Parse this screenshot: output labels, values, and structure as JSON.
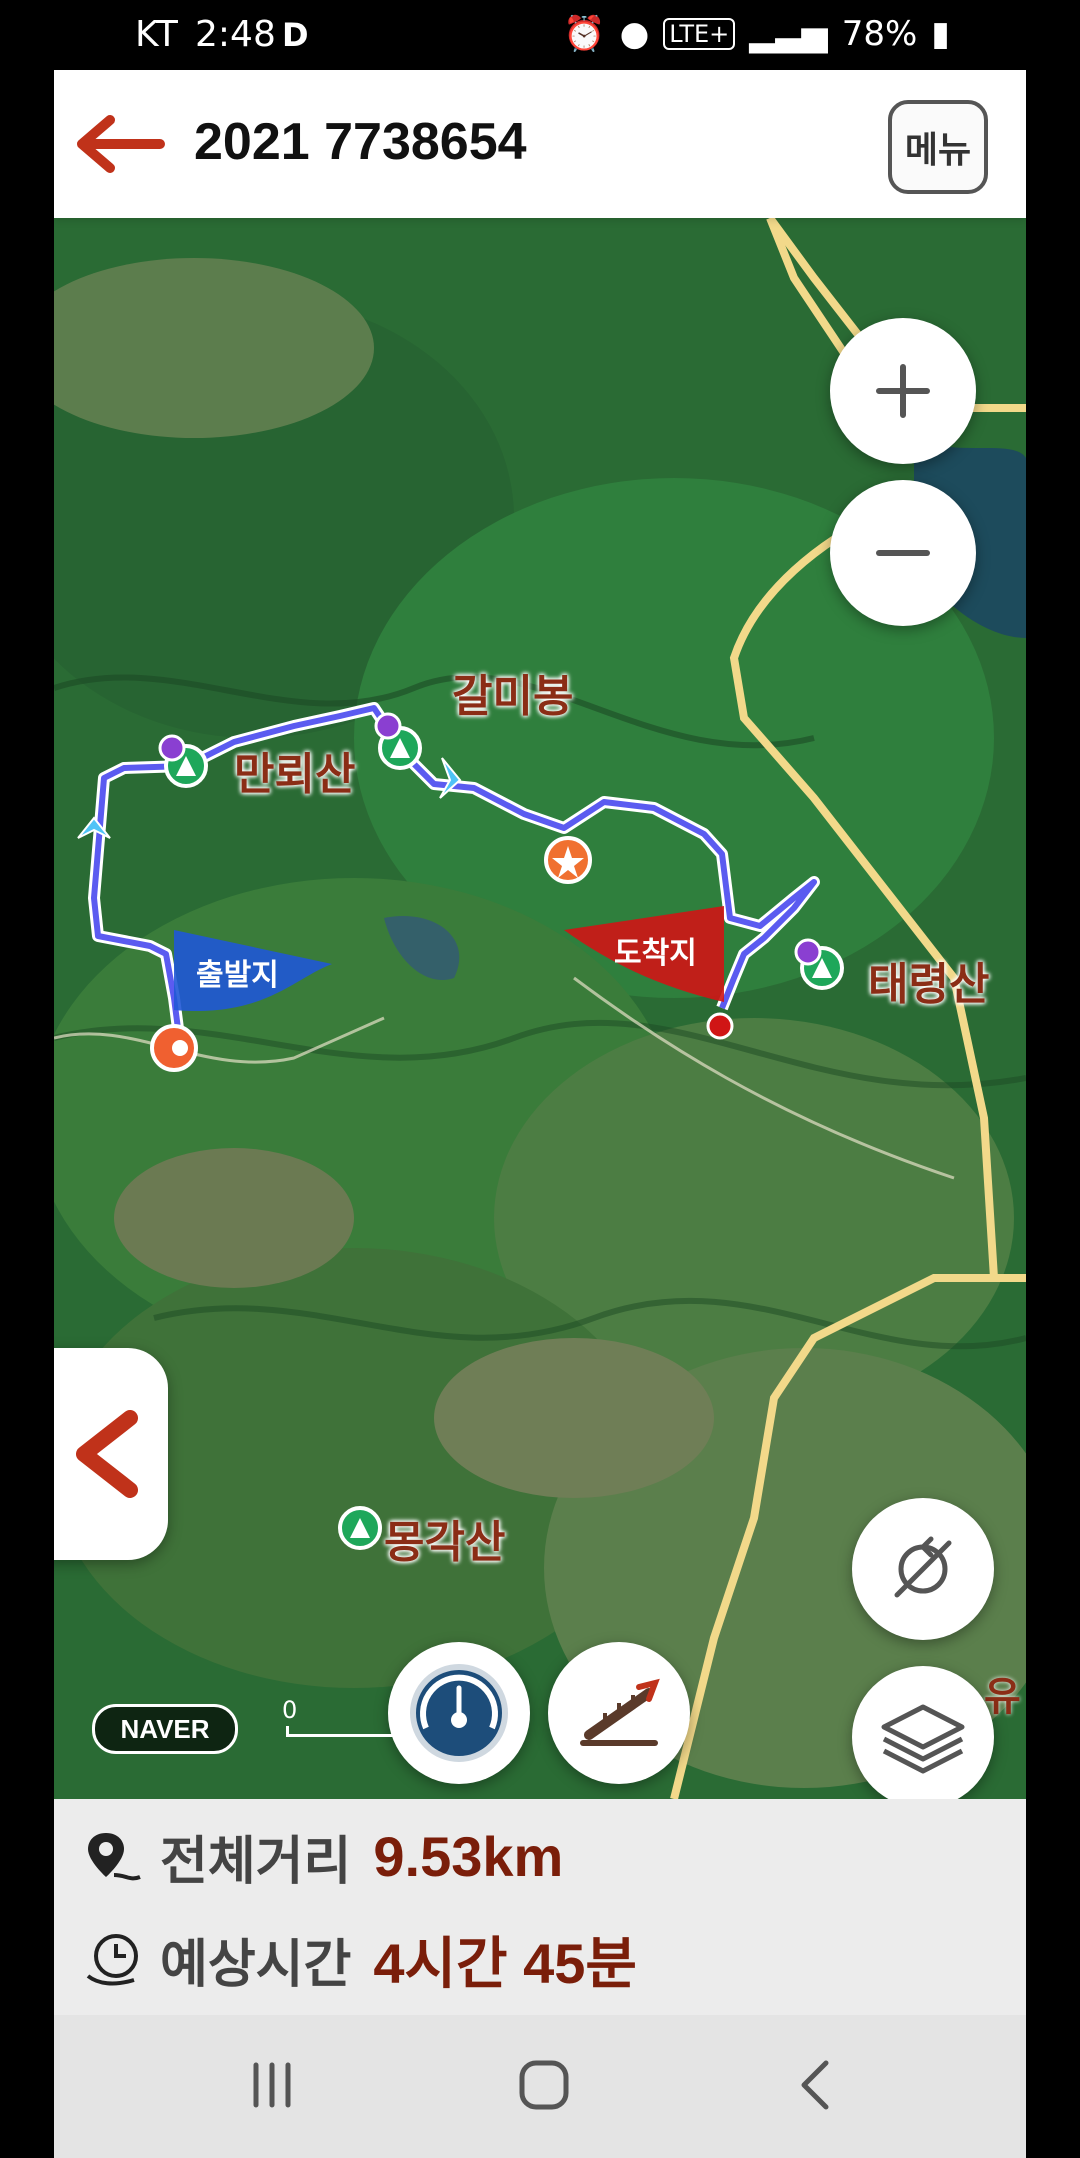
{
  "status_bar": {
    "carrier": "KT",
    "time": "2:48",
    "network": "LTE+",
    "battery": "78%"
  },
  "header": {
    "title": "2021 7738654",
    "menu_label": "메뉴"
  },
  "map": {
    "peaks": [
      {
        "name": "갈미봉"
      },
      {
        "name": "만뢰산"
      },
      {
        "name": "태령산"
      },
      {
        "name": "몽각산"
      }
    ],
    "start_flag": "출발지",
    "end_flag": "도착지",
    "cut_label": "유",
    "provider_logo": "NAVER",
    "scale_start": "0"
  },
  "route_info": {
    "distance_label": "전체거리",
    "distance_value": "9.53km",
    "time_label": "예상시간",
    "time_value": "4시간 45분"
  },
  "colors": {
    "route": "#5b5bf0",
    "accent": "#c0321a",
    "road": "#f2d98a",
    "start_flag": "#2058d6",
    "end_flag": "#d01515"
  }
}
